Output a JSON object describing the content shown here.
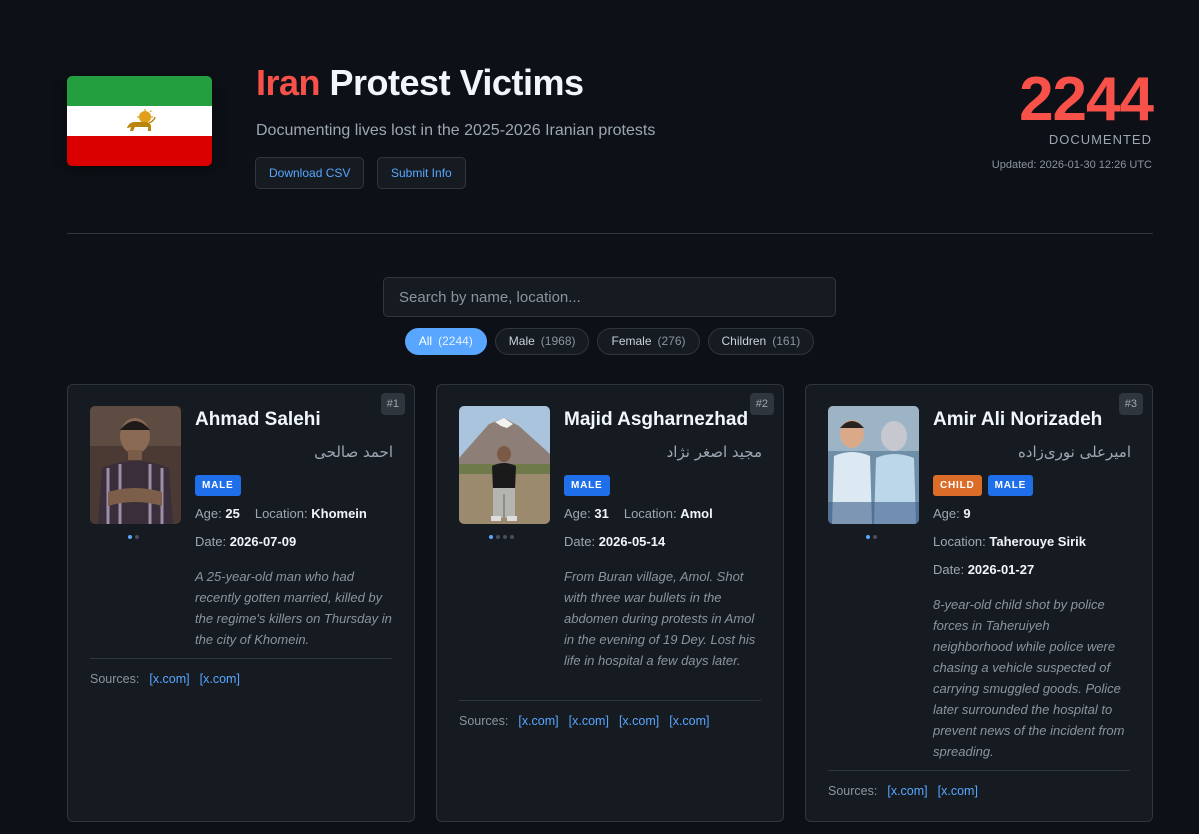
{
  "header": {
    "title_accent": "Iran",
    "title_rest": " Protest Victims",
    "subtitle": "Documenting lives lost in the 2025-2026 Iranian protests",
    "download_label": "Download CSV",
    "submit_label": "Submit Info",
    "count": "2244",
    "count_label": "DOCUMENTED",
    "updated": "Updated: 2026-01-30 12:26 UTC"
  },
  "search": {
    "placeholder": "Search by name, location..."
  },
  "filters": [
    {
      "label": "All",
      "count": "(2244)",
      "active": true
    },
    {
      "label": "Male",
      "count": "(1968)",
      "active": false
    },
    {
      "label": "Female",
      "count": "(276)",
      "active": false
    },
    {
      "label": "Children",
      "count": "(161)",
      "active": false
    }
  ],
  "labels": {
    "age": "Age:",
    "location": "Location:",
    "date": "Date:",
    "sources": "Sources:"
  },
  "victims": [
    {
      "rank": "#1",
      "name": "Ahmad Salehi",
      "name_fa": "احمد صالحی",
      "badges": [
        "MALE"
      ],
      "age": "25",
      "location": "Khomein",
      "date": "2026-07-09",
      "description": "A 25-year-old man who had recently gotten married, killed by the regime's killers on Thursday in the city of Khomein.",
      "sources": [
        "[x.com]",
        "[x.com]"
      ],
      "photo_count": 2
    },
    {
      "rank": "#2",
      "name": "Majid Asgharnezhad",
      "name_fa": "مجید اصغر نژاد",
      "badges": [
        "MALE"
      ],
      "age": "31",
      "location": "Amol",
      "date": "2026-05-14",
      "description": "From Buran village, Amol. Shot with three war bullets in the abdomen during protests in Amol in the evening of 19 Dey. Lost his life in hospital a few days later.",
      "sources": [
        "[x.com]",
        "[x.com]",
        "[x.com]",
        "[x.com]"
      ],
      "photo_count": 4
    },
    {
      "rank": "#3",
      "name": "Amir Ali Norizadeh",
      "name_fa": "امیرعلی نوری‌زاده",
      "badges": [
        "CHILD",
        "MALE"
      ],
      "age": "9",
      "location": "Taherouye Sirik",
      "date": "2026-01-27",
      "description": "8-year-old child shot by police forces in Taheruiyeh neighborhood while police were chasing a vehicle suspected of carrying smuggled goods. Police later surrounded the hospital to prevent news of the incident from spreading.",
      "sources": [
        "[x.com]",
        "[x.com]"
      ],
      "photo_count": 2
    }
  ],
  "colors": {
    "accent_red": "#f85149",
    "link_blue": "#58a6ff",
    "male_badge": "#1f6feb",
    "child_badge": "#db6d28"
  }
}
